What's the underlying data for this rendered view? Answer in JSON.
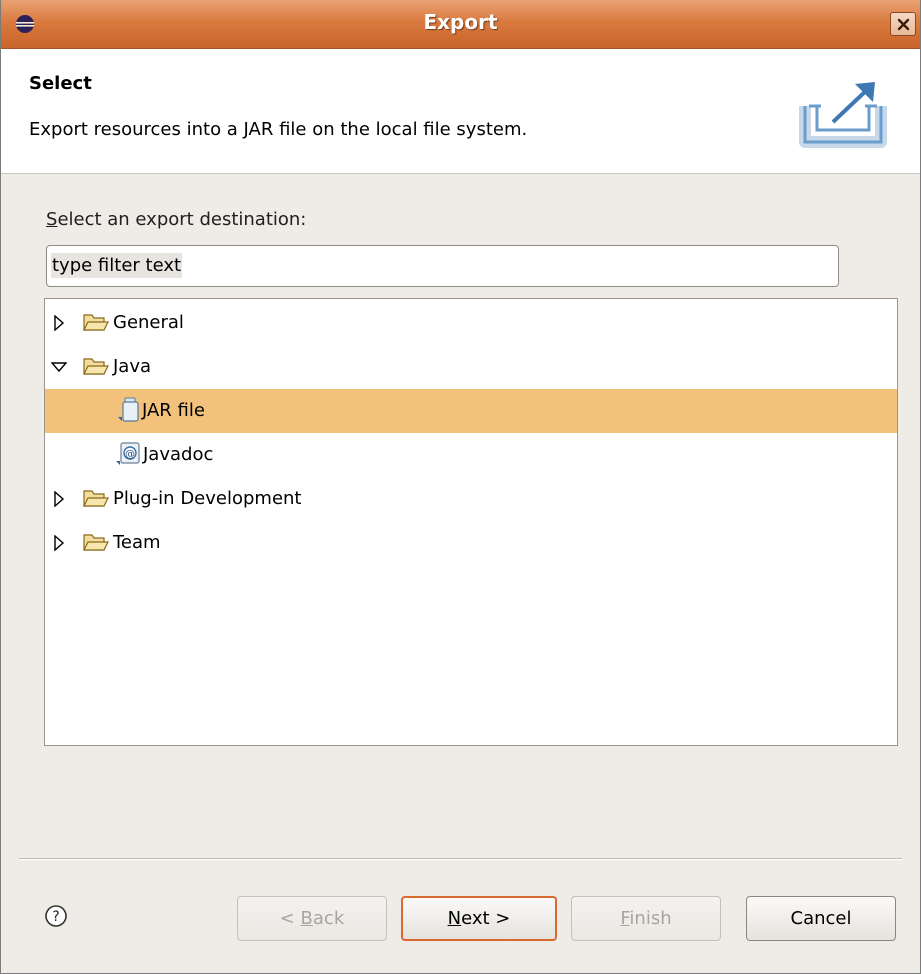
{
  "window": {
    "title": "Export"
  },
  "banner": {
    "title": "Select",
    "description": "Export resources into a JAR file on the local file system."
  },
  "destination": {
    "label_mnemonic": "S",
    "label_rest": "elect an export destination:"
  },
  "filter": {
    "value": "type filter text"
  },
  "tree": {
    "items": [
      {
        "label": "General",
        "expanded": false,
        "icon": "folder-icon",
        "level": 0
      },
      {
        "label": "Java",
        "expanded": true,
        "icon": "folder-icon",
        "level": 0
      },
      {
        "label": "JAR file",
        "icon": "jar-file-icon",
        "level": 1,
        "selected": true
      },
      {
        "label": "Javadoc",
        "icon": "javadoc-icon",
        "level": 1
      },
      {
        "label": "Plug-in Development",
        "expanded": false,
        "icon": "folder-icon",
        "level": 0
      },
      {
        "label": "Team",
        "expanded": false,
        "icon": "folder-icon",
        "level": 0
      }
    ]
  },
  "buttons": {
    "back_prefix": "< ",
    "back_mnemonic": "B",
    "back_rest": "ack",
    "next_mnemonic": "N",
    "next_rest": "ext >",
    "finish_mnemonic": "F",
    "finish_rest": "inish",
    "cancel": "Cancel"
  },
  "colors": {
    "titlebar": "#d97a3f",
    "selection": "#f2c27c",
    "default_button_border": "#d8692f"
  }
}
